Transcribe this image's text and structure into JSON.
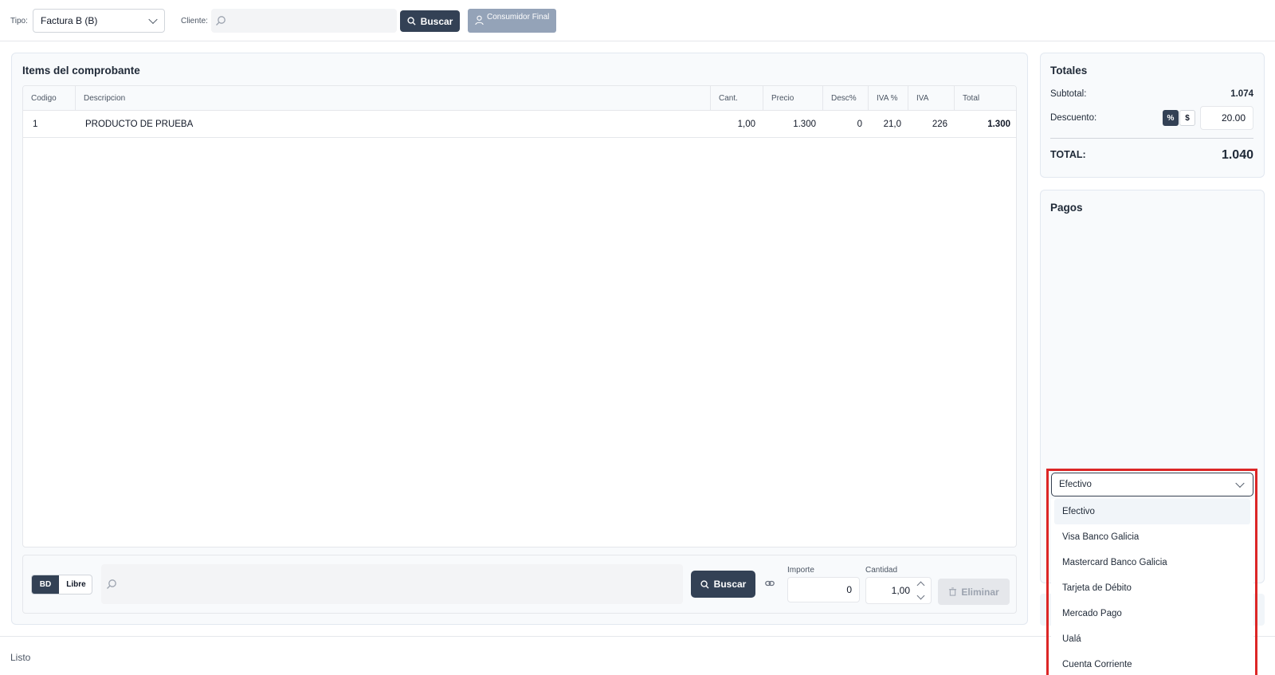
{
  "header": {
    "tipo_label": "Tipo:",
    "tipo_value": "Factura B (B)",
    "cliente_label": "Cliente:",
    "cliente_placeholder": "",
    "buscar_label": "Buscar",
    "consumidor_final_label": "Consumidor Final"
  },
  "items": {
    "title": "Items del comprobante",
    "columns": [
      "Codigo",
      "Descripcion",
      "Cant.",
      "Precio",
      "Desc%",
      "IVA %",
      "IVA",
      "Total"
    ],
    "rows": [
      {
        "codigo": "1",
        "descripcion": "PRODUCTO DE PRUEBA",
        "cant": "1,00",
        "precio": "1.300",
        "desc": "0",
        "iva_pct": "21,0",
        "iva": "226",
        "total": "1.300"
      }
    ]
  },
  "entry": {
    "mode_bd": "BD",
    "mode_libre": "Libre",
    "buscar_label": "Buscar",
    "importe_label": "Importe",
    "importe_value": "0",
    "cantidad_label": "Cantidad",
    "cantidad_value": "1,00",
    "eliminar_label": "Eliminar"
  },
  "totales": {
    "title": "Totales",
    "subtotal_label": "Subtotal:",
    "subtotal_value": "1.074",
    "descuento_label": "Descuento:",
    "toggle_pct": "%",
    "toggle_dollar": "$",
    "descuento_value": "20.00",
    "total_label": "TOTAL:",
    "total_value": "1.040"
  },
  "pagos": {
    "title": "Pagos",
    "selected": "Efectivo",
    "options": [
      "Efectivo",
      "Visa Banco Galicia",
      "Mastercard Banco Galicia",
      "Tarjeta de Débito",
      "Mercado Pago",
      "Ualá",
      "Cuenta Corriente"
    ]
  },
  "status": {
    "text": "Listo"
  },
  "colors": {
    "accent": "#334155",
    "highlight": "#dc2626",
    "muted": "#94a3b8"
  }
}
